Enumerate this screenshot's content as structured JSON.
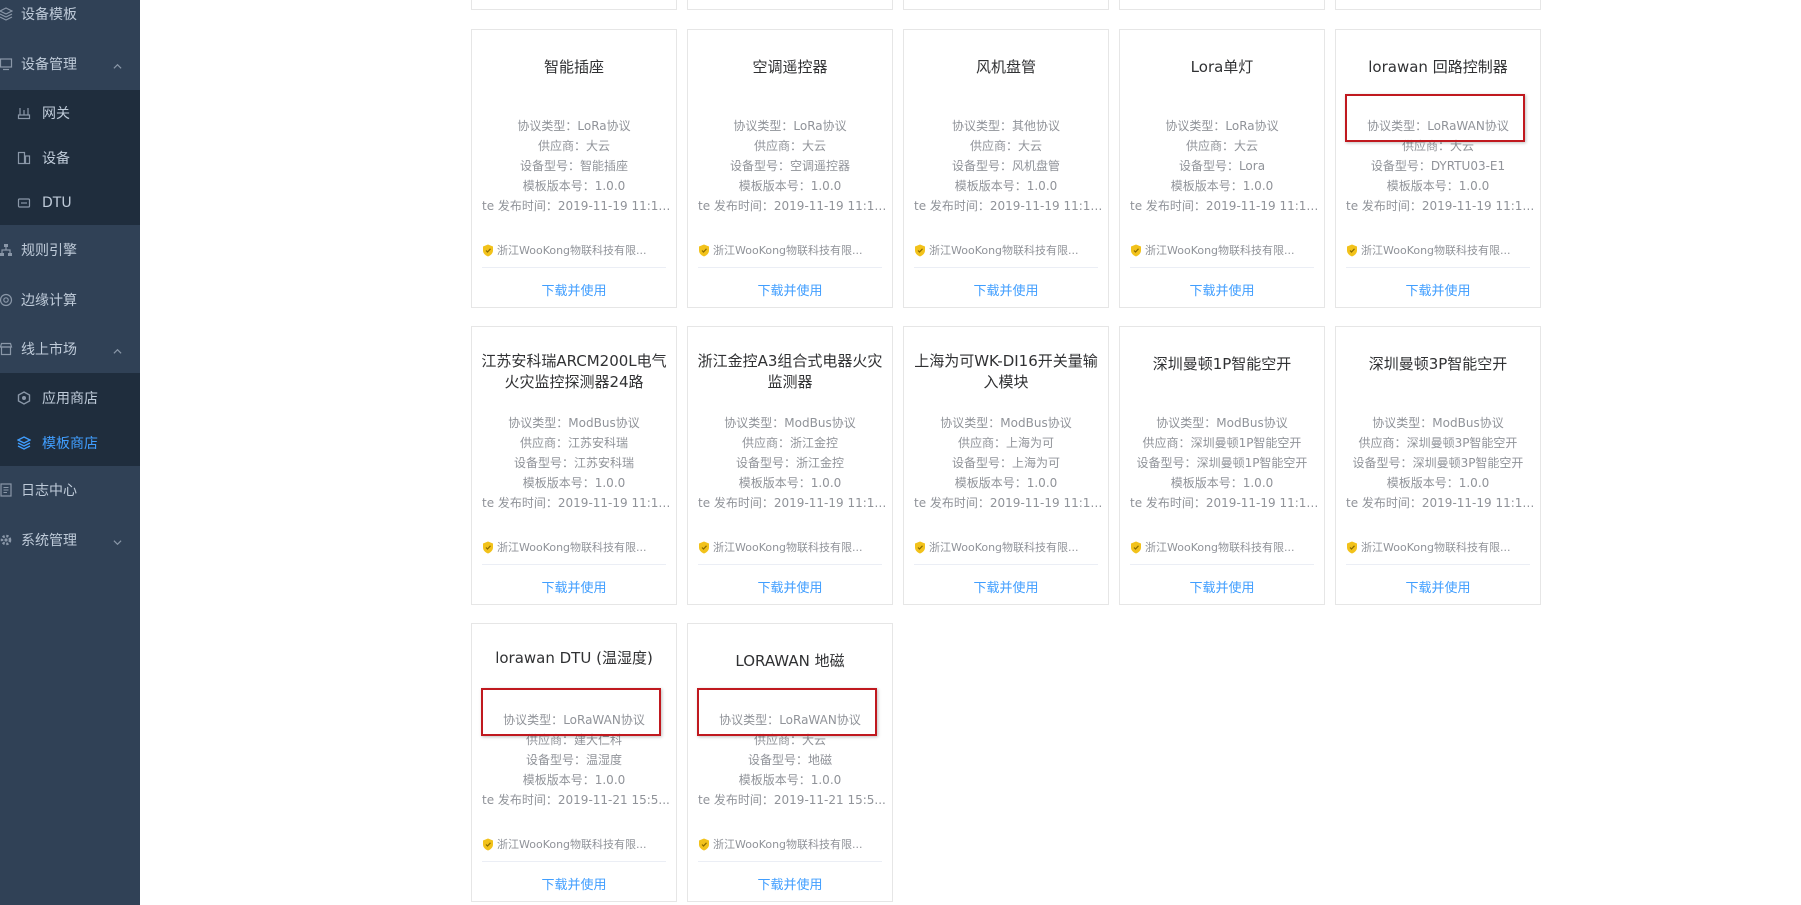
{
  "sidebar": {
    "items": [
      {
        "label": "设备模板",
        "icon": "layers-icon"
      },
      {
        "label": "设备管理",
        "icon": "device-icon",
        "expanded": true
      },
      {
        "label": "规则引擎",
        "icon": "flow-icon"
      },
      {
        "label": "边缘计算",
        "icon": "compute-icon"
      },
      {
        "label": "线上市场",
        "icon": "store-icon",
        "expanded": true
      },
      {
        "label": "日志中心",
        "icon": "log-icon"
      },
      {
        "label": "系统管理",
        "icon": "settings-icon",
        "expanded": false
      }
    ],
    "device_sub": [
      {
        "label": "网关",
        "icon": "gateway-icon"
      },
      {
        "label": "设备",
        "icon": "device-icon"
      },
      {
        "label": "DTU",
        "icon": "dtu-icon"
      }
    ],
    "market_sub": [
      {
        "label": "应用商店",
        "icon": "app-store-icon"
      },
      {
        "label": "模板商店",
        "icon": "template-store-icon",
        "active": true
      }
    ]
  },
  "labels": {
    "protocol": "协议类型：",
    "vendor": "供应商：",
    "model": "设备型号：",
    "version": "模板版本号：",
    "published": "te 发布时间：",
    "download": "下载并使用"
  },
  "cards": [
    {
      "title": "智能插座",
      "protocol": "LoRa协议",
      "vendor": "大云",
      "model": "智能插座",
      "version": "1.0.0",
      "published": "2019-11-19 11:11...",
      "company": "浙江WooKong物联科技有限..."
    },
    {
      "title": "空调遥控器",
      "protocol": "LoRa协议",
      "vendor": "大云",
      "model": "空调遥控器",
      "version": "1.0.0",
      "published": "2019-11-19 11:11...",
      "company": "浙江WooKong物联科技有限..."
    },
    {
      "title": "风机盘管",
      "protocol": "其他协议",
      "vendor": "大云",
      "model": "风机盘管",
      "version": "1.0.0",
      "published": "2019-11-19 11:11...",
      "company": "浙江WooKong物联科技有限..."
    },
    {
      "title": "Lora单灯",
      "protocol": "LoRa协议",
      "vendor": "大云",
      "model": "Lora",
      "version": "1.0.0",
      "published": "2019-11-19 11:11...",
      "company": "浙江WooKong物联科技有限..."
    },
    {
      "title": "lorawan 回路控制器",
      "protocol": "LoRaWAN协议",
      "vendor": "大云",
      "model": "DYRTU03-E1",
      "version": "1.0.0",
      "published": "2019-11-19 11:11...",
      "company": "浙江WooKong物联科技有限...",
      "highlight": true
    },
    {
      "title": "江苏安科瑞ARCM200L电气火灾监控探测器24路",
      "protocol": "ModBus协议",
      "vendor": "江苏安科瑞",
      "model": "江苏安科瑞",
      "version": "1.0.0",
      "published": "2019-11-19 11:11...",
      "company": "浙江WooKong物联科技有限..."
    },
    {
      "title": "浙江金控A3组合式电器火灾监测器",
      "protocol": "ModBus协议",
      "vendor": "浙江金控",
      "model": "浙江金控",
      "version": "1.0.0",
      "published": "2019-11-19 11:11...",
      "company": "浙江WooKong物联科技有限..."
    },
    {
      "title": "上海为可WK-DI16开关量输入模块",
      "protocol": "ModBus协议",
      "vendor": "上海为可",
      "model": "上海为可",
      "version": "1.0.0",
      "published": "2019-11-19 11:11...",
      "company": "浙江WooKong物联科技有限..."
    },
    {
      "title": "深圳曼顿1P智能空开",
      "protocol": "ModBus协议",
      "vendor": "深圳曼顿1P智能空开",
      "model": "深圳曼顿1P智能空开",
      "version": "1.0.0",
      "published": "2019-11-19 11:11...",
      "company": "浙江WooKong物联科技有限..."
    },
    {
      "title": "深圳曼顿3P智能空开",
      "protocol": "ModBus协议",
      "vendor": "深圳曼顿3P智能空开",
      "model": "深圳曼顿3P智能空开",
      "version": "1.0.0",
      "published": "2019-11-19 11:11...",
      "company": "浙江WooKong物联科技有限..."
    },
    {
      "title": "lorawan DTU (温湿度)",
      "protocol": "LoRaWAN协议",
      "vendor": "建大仁科",
      "model": "温湿度",
      "version": "1.0.0",
      "published": "2019-11-21 15:5...",
      "company": "浙江WooKong物联科技有限...",
      "highlight": true
    },
    {
      "title": "LORAWAN 地磁",
      "protocol": "LoRaWAN协议",
      "vendor": "大云",
      "model": "地磁",
      "version": "1.0.0",
      "published": "2019-11-21 15:5...",
      "company": "浙江WooKong物联科技有限...",
      "highlight": true
    }
  ],
  "colors": {
    "sidebar_bg": "#304156",
    "submenu_bg": "#1f2d3d",
    "accent": "#409eff",
    "highlight_border": "#c0191f"
  }
}
